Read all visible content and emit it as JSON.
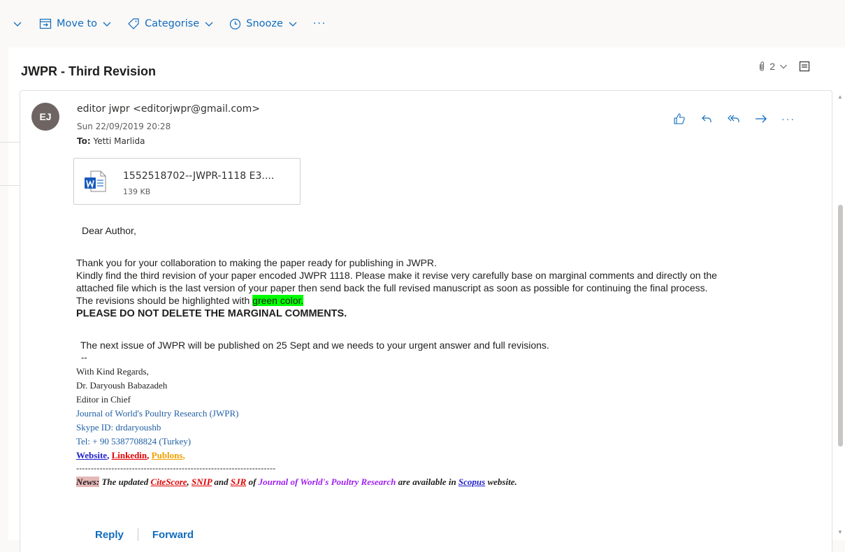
{
  "toolbar": {
    "move_to": "Move to",
    "categorise": "Categorise",
    "snooze": "Snooze",
    "more": "···"
  },
  "message": {
    "subject": "JWPR - Third Revision",
    "attachment_count": "2",
    "avatar_initials": "EJ",
    "from": "editor jwpr <editorjwpr@gmail.com>",
    "date": "Sun 22/09/2019 20:28",
    "to_label": "To:",
    "to_value": "Yetti Marlida",
    "more_actions": "···"
  },
  "attachment": {
    "name": "1552518702--JWPR-1118 E3....",
    "size": "139 KB",
    "icon": "word-document-icon"
  },
  "body": {
    "greeting": "Dear Author,",
    "p1": "Thank you for your collaboration to making the paper ready for publishing in JWPR.",
    "p2a": "Kindly find the third revision of your paper encoded JWPR 1118. Please make it revise very carefully base on marginal comments and directly on the",
    "p2b": "attached file which is the last version of your paper then send back the full revised manuscript as soon as possible for continuing the final process.",
    "p3_prefix": "The revisions should be highlighted with ",
    "p3_highlight": "green color.",
    "warning": "PLEASE DO NOT DELETE THE MARGINAL COMMENTS.",
    "next_issue": "The next issue of JWPR will be published on 25 Sept and we needs to your urgent answer and full revisions.",
    "dashes": "--"
  },
  "signature": {
    "regards": "With Kind Regards,",
    "name": "Dr. Daryoush Babazadeh",
    "role": "Editor in Chief",
    "journal": "Journal of World's Poultry Research (JWPR)",
    "skype": "Skype ID: drdaryoushb",
    "tel": "Tel: + 90 5387708824 (Turkey)",
    "link_website": "Website",
    "comma1": ", ",
    "link_linkedin": "Linkedin",
    "comma2": ", ",
    "link_publons": "Publons",
    "comma3": ",",
    "divider": "--------------------------------------------------------------------"
  },
  "news": {
    "label": "News:",
    "t1": " The updated ",
    "citescore": "CiteScore",
    "comma": ", ",
    "snip": "SNIP",
    "t2": " and ",
    "sjr": "SJR",
    "t3": " of ",
    "journal": "Journal of World's Poultry Research",
    "t4": " are available in ",
    "scopus": "Scopus",
    "t5": " website."
  },
  "footer": {
    "reply": "Reply",
    "forward": "Forward"
  },
  "colors": {
    "accent": "#0f6cbd",
    "highlight": "#00ff00",
    "avatar": "#6e6461"
  }
}
